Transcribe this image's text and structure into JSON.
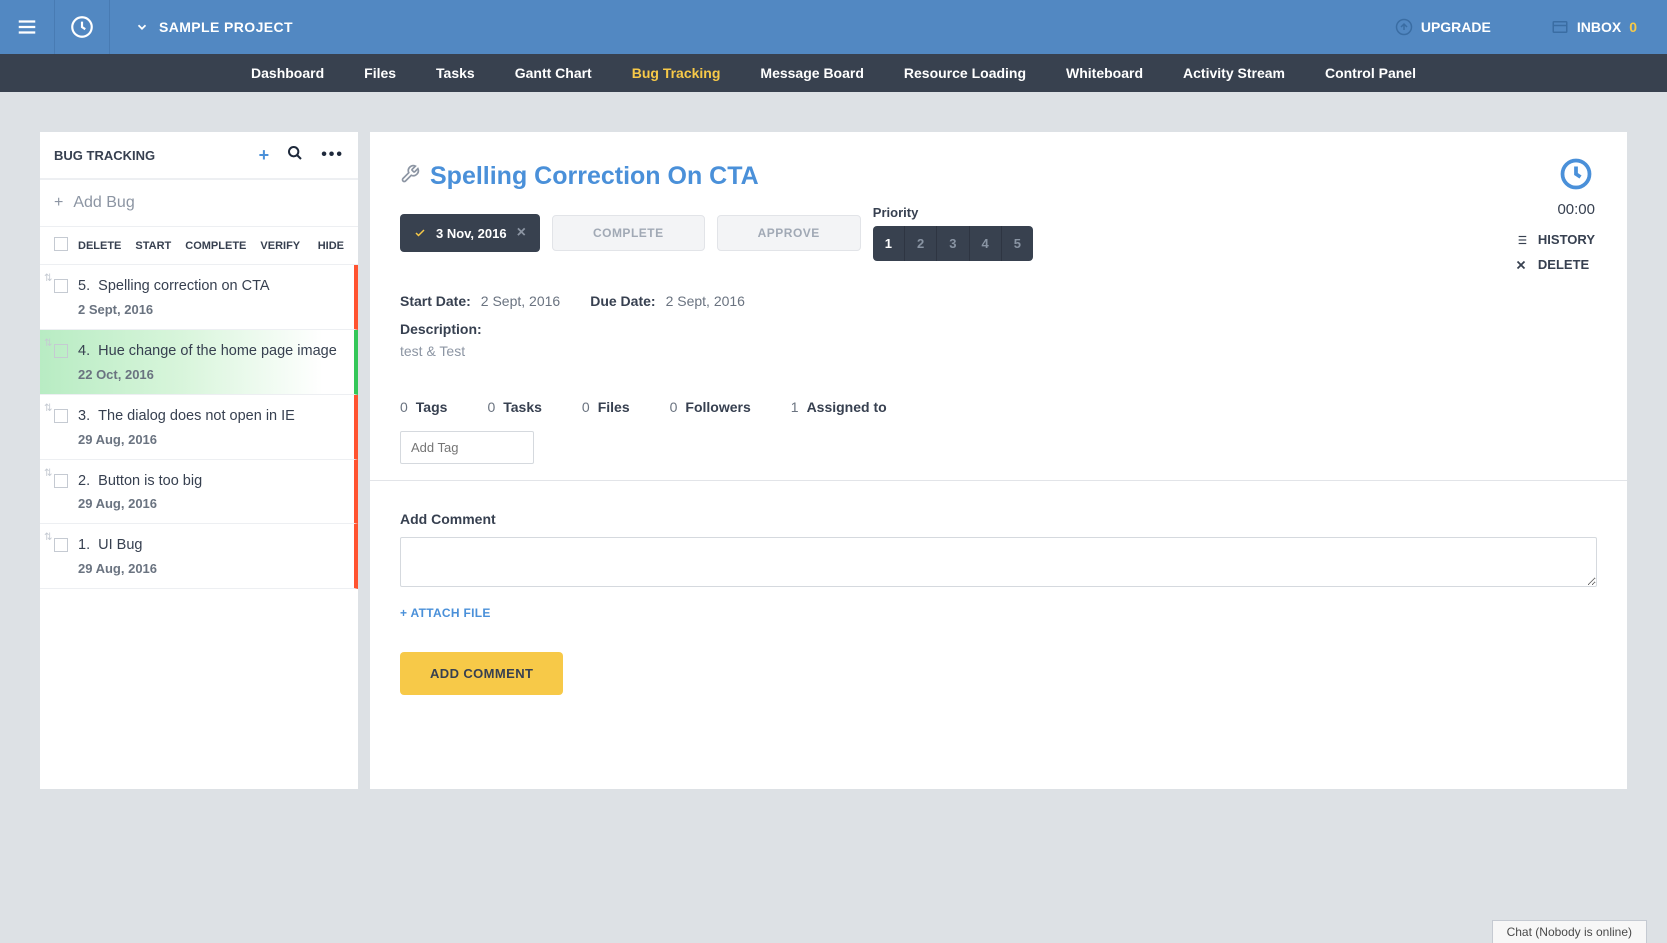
{
  "topbar": {
    "project_name": "SAMPLE PROJECT",
    "upgrade_label": "UPGRADE",
    "inbox_label": "INBOX",
    "inbox_count": "0"
  },
  "nav": {
    "items": [
      {
        "label": "Dashboard",
        "active": false
      },
      {
        "label": "Files",
        "active": false
      },
      {
        "label": "Tasks",
        "active": false
      },
      {
        "label": "Gantt Chart",
        "active": false
      },
      {
        "label": "Bug Tracking",
        "active": true
      },
      {
        "label": "Message Board",
        "active": false
      },
      {
        "label": "Resource Loading",
        "active": false
      },
      {
        "label": "Whiteboard",
        "active": false
      },
      {
        "label": "Activity Stream",
        "active": false
      },
      {
        "label": "Control Panel",
        "active": false
      }
    ]
  },
  "sidebar": {
    "title": "BUG TRACKING",
    "add_bug_label": "Add Bug",
    "headers": {
      "delete": "DELETE",
      "start": "START",
      "complete": "COMPLETE",
      "verify": "VERIFY",
      "hide": "HIDE"
    },
    "bugs": [
      {
        "num": "5.",
        "title": "Spelling correction on CTA",
        "date": "2 Sept, 2016",
        "status": "red"
      },
      {
        "num": "4.",
        "title": "Hue change of the home page image",
        "date": "22 Oct, 2016",
        "status": "green"
      },
      {
        "num": "3.",
        "title": "The dialog does not open in IE",
        "date": "29 Aug, 2016",
        "status": "red"
      },
      {
        "num": "2.",
        "title": "Button is too big",
        "date": "29 Aug, 2016",
        "status": "red"
      },
      {
        "num": "1.",
        "title": "UI Bug",
        "date": "29 Aug, 2016",
        "status": "red"
      }
    ]
  },
  "detail": {
    "title": "Spelling Correction On CTA",
    "date_pill": "3 Nov, 2016",
    "complete_btn": "COMPLETE",
    "approve_btn": "APPROVE",
    "priority_label": "Priority",
    "priority_active": "1",
    "priority_options": [
      "1",
      "2",
      "3",
      "4",
      "5"
    ],
    "timer": "00:00",
    "history_label": "HISTORY",
    "delete_label": "DELETE",
    "start_date_label": "Start Date:",
    "start_date_value": "2 Sept, 2016",
    "due_date_label": "Due Date:",
    "due_date_value": "2 Sept, 2016",
    "description_label": "Description:",
    "description_value": "test & Test",
    "counts": {
      "tags": {
        "num": "0",
        "label": "Tags"
      },
      "tasks": {
        "num": "0",
        "label": "Tasks"
      },
      "files": {
        "num": "0",
        "label": "Files"
      },
      "followers": {
        "num": "0",
        "label": "Followers"
      },
      "assigned": {
        "num": "1",
        "label": "Assigned to"
      }
    },
    "add_tag_placeholder": "Add Tag",
    "add_comment_label": "Add Comment",
    "attach_file_label": "+ ATTACH FILE",
    "add_comment_btn": "ADD COMMENT"
  },
  "chat": {
    "label": "Chat (Nobody is online)"
  }
}
